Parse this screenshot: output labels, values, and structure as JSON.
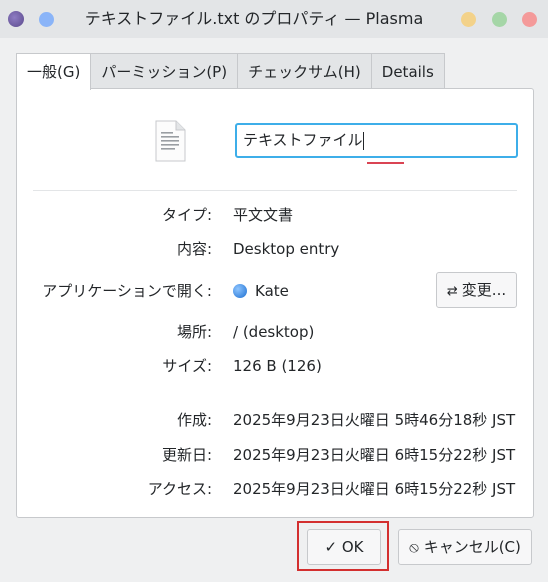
{
  "window": {
    "title": "テキストファイル.txt のプロパティ — Plasma"
  },
  "tabs": [
    {
      "label": "一般(G)",
      "active": true
    },
    {
      "label": "パーミッション(P)",
      "active": false
    },
    {
      "label": "チェックサム(H)",
      "active": false
    },
    {
      "label": "Details",
      "active": false
    }
  ],
  "general": {
    "file_icon": "text-file-icon",
    "name_value": "テキストファイル",
    "props": [
      {
        "key": "タイプ:",
        "value": "平文文書"
      },
      {
        "key": "内容:",
        "value": "Desktop entry"
      },
      {
        "key": "アプリケーションで開く:",
        "value": "Kate",
        "icon": "kate-icon"
      },
      {
        "key": "場所:",
        "value": "/ (desktop)"
      },
      {
        "key": "サイズ:",
        "value": "126 B (126)"
      },
      {
        "key": "作成:",
        "value": "2025年9月23日火曜日 5時46分18秒 JST"
      },
      {
        "key": "更新日:",
        "value": "2025年9月23日火曜日 6時15分22秒 JST"
      },
      {
        "key": "アクセス:",
        "value": "2025年9月23日火曜日 6時15分22秒 JST"
      }
    ],
    "change_button": {
      "label": "変更...",
      "icon": "swap-icon"
    }
  },
  "footer": {
    "ok": {
      "label": "OK",
      "icon": "check-icon"
    },
    "cancel": {
      "label": "キャンセル(C)",
      "icon": "cancel-icon"
    }
  },
  "colors": {
    "accent": "#3daee9",
    "highlight": "#d32f2f",
    "spellcheck": "#da4453"
  }
}
